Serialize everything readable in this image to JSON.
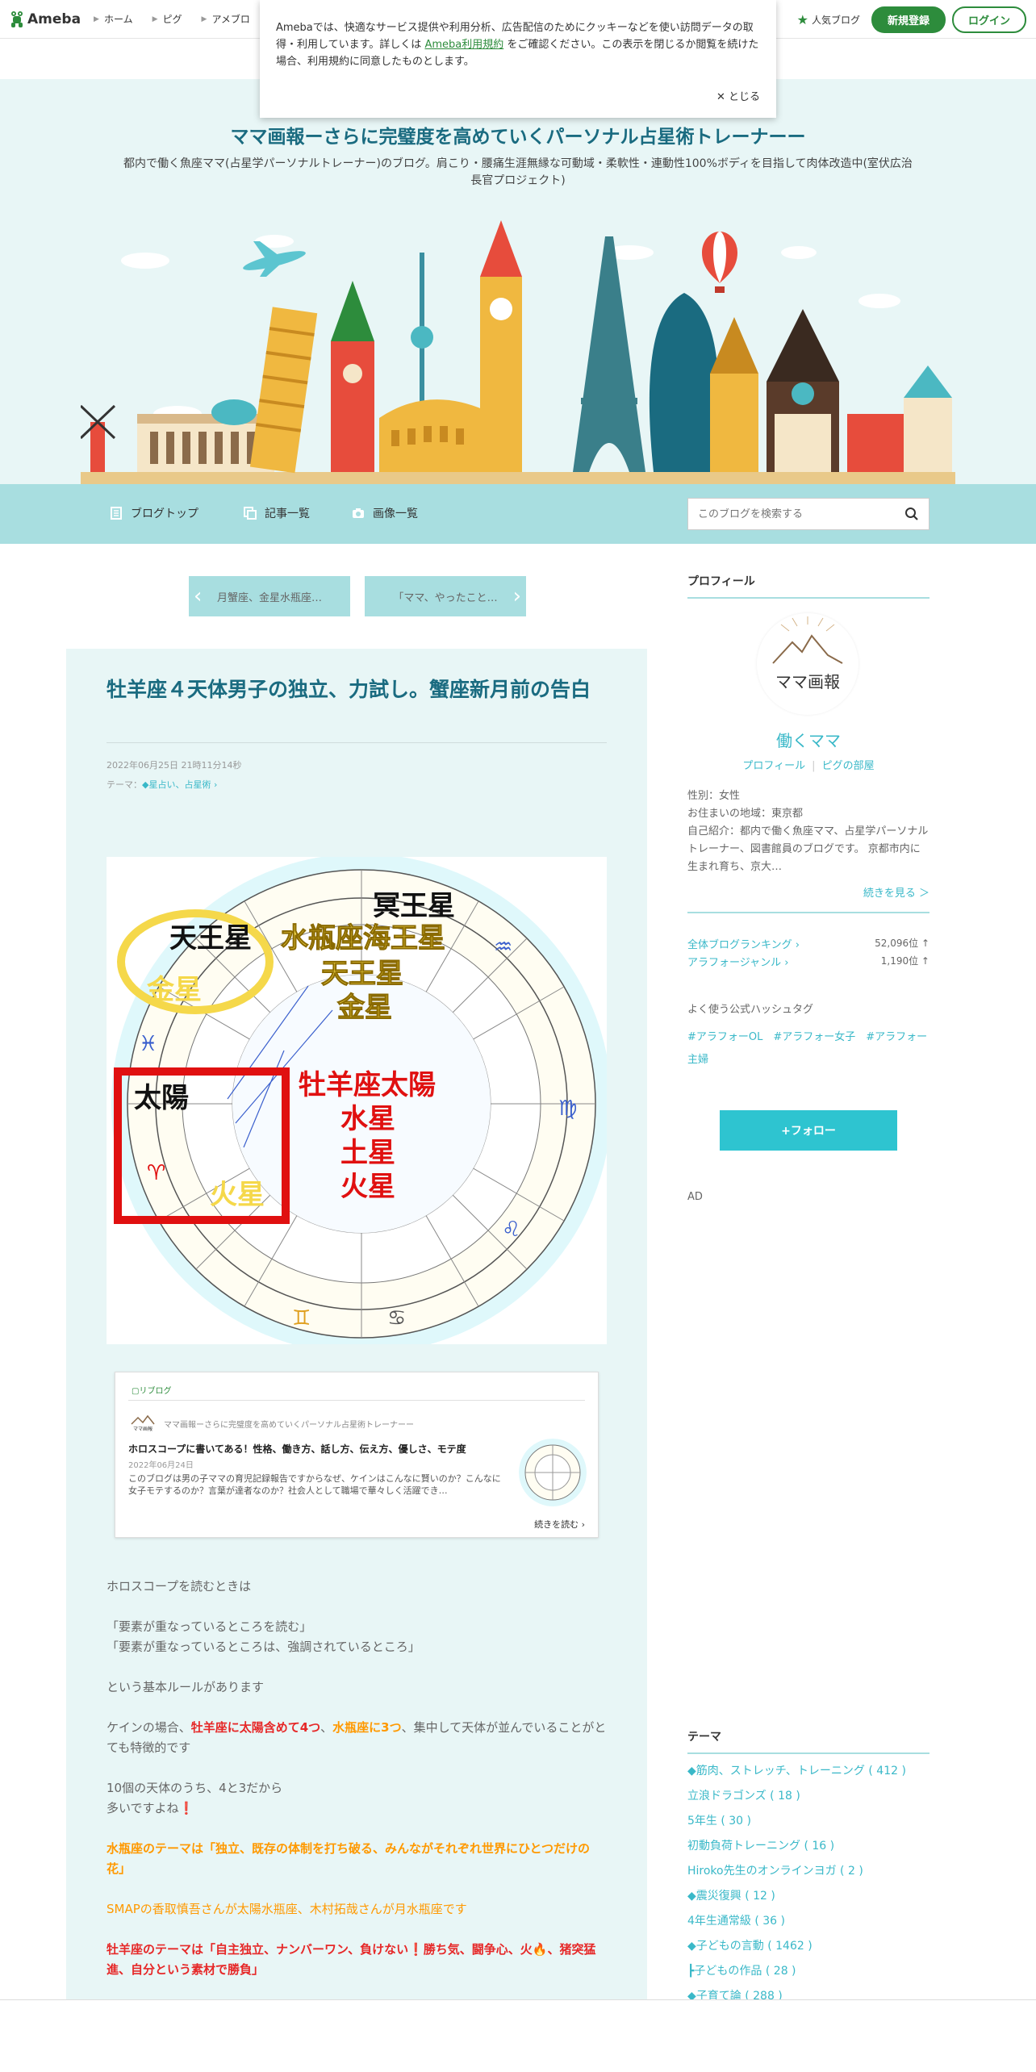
{
  "topbar": {
    "logo_text": "Ameba",
    "nav": [
      "ホーム",
      "ピグ",
      "アメブロ"
    ],
    "popular_label": "人気ブログ",
    "register_label": "新規登録",
    "login_label": "ログイン"
  },
  "cookie": {
    "text_before": "Amebaでは、快適なサービス提供や利用分析、広告配信のためにクッキーなどを使い訪問データの取得・利用しています。詳しくは",
    "link": "Ameba利用規約",
    "text_after": "をご確認ください。この表示を閉じるか閲覧を続けた場合、利用規約に同意したものとします。",
    "close_label": "とじる"
  },
  "header": {
    "title": "ママ画報ーさらに完璧度を高めていくパーソナル占星術トレーナーー",
    "description": "都内で働く魚座ママ(占星学パーソナルトレーナー)のブログ。肩こり・腰痛生涯無縁な可動域・柔軟性・連動性100%ボディを目指して肉体改造中(室伏広治長官プロジェクト)"
  },
  "navbar": {
    "items": [
      "ブログトップ",
      "記事一覧",
      "画像一覧"
    ],
    "search_placeholder": "このブログを検索する"
  },
  "pager": {
    "prev": "月蟹座、金星水瓶座…",
    "next": "「ママ、やったこと…"
  },
  "article": {
    "title": "牡羊座４天体男子の独立、力試し。蟹座新月前の告白",
    "date": "2022年06月25日 21時11分14秒",
    "theme_label": "テーマ：",
    "theme": "◆星占い、占星術",
    "chart_labels": {
      "meio": "冥王星",
      "tenno1": "天王星",
      "aquarius_neptune": "水瓶座海王星",
      "tenno2": "天王星",
      "kinsei1": "金星",
      "kinsei2": "金星",
      "taiyo": "太陽",
      "aries_sun": "牡羊座太陽",
      "suisei": "水星",
      "dosei": "土星",
      "kasei1": "火星",
      "kasei2": "火星"
    },
    "reblog": {
      "label": "リブログ",
      "source": "ママ画報ーさらに完璧度を高めていくパーソナル占星術トレーナーー",
      "title": "ホロスコープに書いてある！性格、働き方、話し方、伝え方、優しさ、モテ度",
      "date": "2022年06月24日",
      "excerpt": "このブログは男の子ママの育児記録報告ですからなぜ、ケインはこんなに賢いのか？こんなに女子モテするのか？言葉が達者なのか？社会人として職場で華々しく活躍でき…",
      "more": "続きを読む"
    },
    "body": {
      "p1": "ホロスコープを読むときは",
      "p2a": "「要素が重なっているところを読む」",
      "p2b": "「要素が重なっているところは、強調されているところ」",
      "p3": "という基本ルールがあります",
      "p4a": "ケインの場合、",
      "p4b": "牡羊座に太陽含めて4つ",
      "p4c": "、",
      "p4d": "水瓶座に3つ",
      "p4e": "、集中して天体が並んでいることがとても特徴的です",
      "p5a": "10個の天体のうち、4と3だから",
      "p5b": "多いですよね",
      "p5c": "❗",
      "p6": "水瓶座のテーマは「独立、既存の体制を打ち破る、みんながそれぞれ世界にひとつだけの花」",
      "p7": "SMAPの香取慎吾さんが太陽水瓶座、木村拓哉さんが月水瓶座です",
      "p8a": "牡羊座のテーマは「自主独立、ナンバーワン、負けない",
      "p8b": "❗",
      "p8c": "勝ち気、闘争心、火",
      "p8d": "🔥",
      "p8e": "、猪突猛進、自分という素材で勝負」"
    }
  },
  "sidebar": {
    "profile_heading": "プロフィール",
    "avatar_text": "ママ画報",
    "name": "働くママ",
    "link_profile": "プロフィール",
    "link_pig": "ピグの部屋",
    "info": [
      "性別：女性",
      "お住まいの地域：東京都",
      "自己紹介：都内で働く魚座ママ、占星学パーソナルトレーナー、図書館員のブログです。 京都市内に生まれ育ち、京大…"
    ],
    "more": "続きを見る ＞",
    "rank1_label": "全体ブログランキング",
    "rank1_value": "52,096位 ↑",
    "rank2_label": "アラフォージャンル",
    "rank2_value": "1,190位 ↑",
    "hashtag_heading": "よく使う公式ハッシュタグ",
    "hashtags": "#アラフォーOL　#アラフォー女子　#アラフォー主婦",
    "follow": "+フォロー",
    "ad": "AD",
    "theme_heading": "テーマ",
    "themes": [
      "◆筋肉、ストレッチ、トレーニング ( 412 )",
      "立浪ドラゴンズ ( 18 )",
      "5年生 ( 30 )",
      "初動負荷トレーニング ( 16 )",
      "Hiroko先生のオンラインヨガ ( 2 )",
      "◆震災復興 ( 12 )",
      "4年生通常級 ( 36 )",
      "◆子どもの言動 ( 1462 )",
      "┣子どもの作品 ( 28 )",
      "◆子育て論 ( 288 )"
    ]
  },
  "colors": {
    "brand_green": "#2d8c3c",
    "title_teal": "#1a6b80",
    "link_cyan": "#39b8c8",
    "nav_bg": "#a8dee0",
    "header_bg": "#e8f6f6",
    "red": "#e62828",
    "orange": "#ff9900"
  }
}
